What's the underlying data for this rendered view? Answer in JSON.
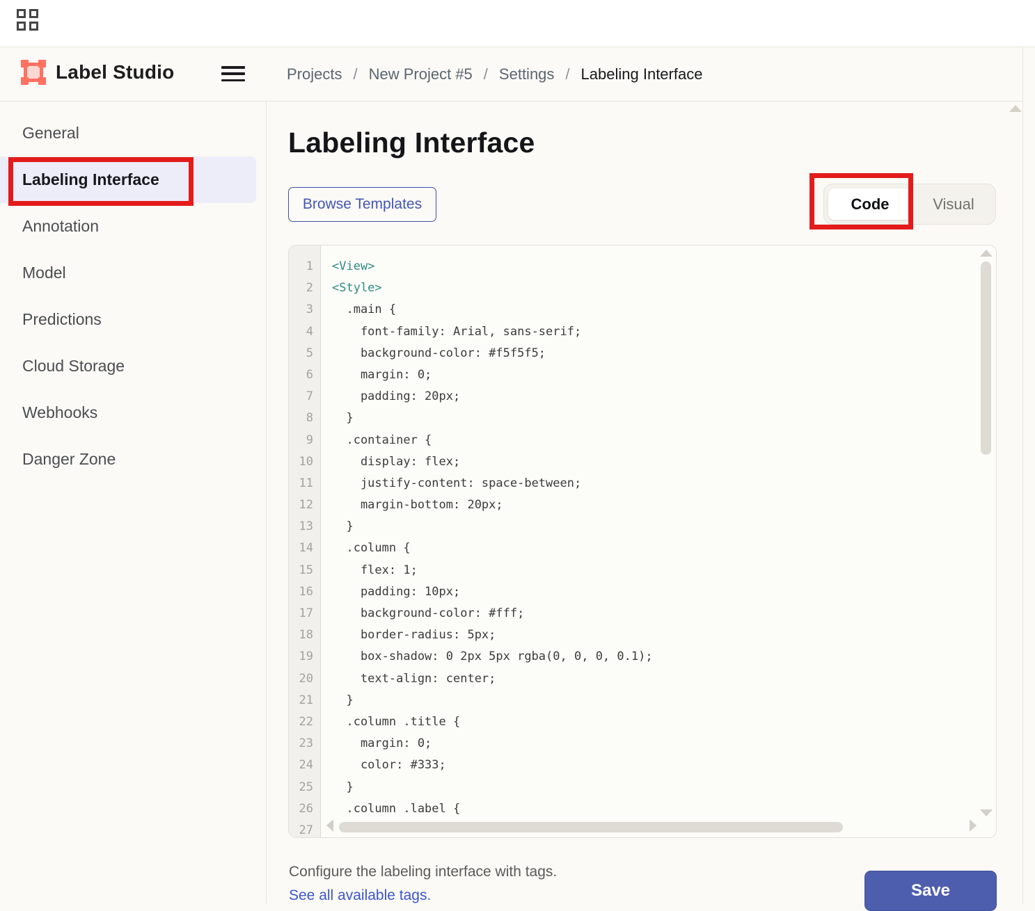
{
  "topbar": {
    "apps_icon": "apps-grid-icon"
  },
  "header": {
    "brand": "Label Studio",
    "separator": "/",
    "breadcrumbs": [
      "Projects",
      "New Project #5",
      "Settings",
      "Labeling Interface"
    ]
  },
  "sidebar": {
    "items": [
      {
        "label": "General",
        "active": false
      },
      {
        "label": "Labeling Interface",
        "active": true
      },
      {
        "label": "Annotation",
        "active": false
      },
      {
        "label": "Model",
        "active": false
      },
      {
        "label": "Predictions",
        "active": false
      },
      {
        "label": "Cloud Storage",
        "active": false
      },
      {
        "label": "Webhooks",
        "active": false
      },
      {
        "label": "Danger Zone",
        "active": false
      }
    ]
  },
  "main": {
    "title": "Labeling Interface",
    "browse_templates": "Browse Templates",
    "toggle": {
      "options": [
        "Code",
        "Visual"
      ],
      "active": "Code"
    },
    "editor": {
      "lines": [
        {
          "n": 1,
          "t": "<View>",
          "k": "tag"
        },
        {
          "n": 2,
          "t": "<Style>",
          "k": "tag"
        },
        {
          "n": 3,
          "t": "  .main {",
          "k": "code"
        },
        {
          "n": 4,
          "t": "    font-family: Arial, sans-serif;",
          "k": "code"
        },
        {
          "n": 5,
          "t": "    background-color: #f5f5f5;",
          "k": "code"
        },
        {
          "n": 6,
          "t": "    margin: 0;",
          "k": "code"
        },
        {
          "n": 7,
          "t": "    padding: 20px;",
          "k": "code"
        },
        {
          "n": 8,
          "t": "  }",
          "k": "code"
        },
        {
          "n": 9,
          "t": "  .container {",
          "k": "code"
        },
        {
          "n": 10,
          "t": "    display: flex;",
          "k": "code"
        },
        {
          "n": 11,
          "t": "    justify-content: space-between;",
          "k": "code"
        },
        {
          "n": 12,
          "t": "    margin-bottom: 20px;",
          "k": "code"
        },
        {
          "n": 13,
          "t": "  }",
          "k": "code"
        },
        {
          "n": 14,
          "t": "  .column {",
          "k": "code"
        },
        {
          "n": 15,
          "t": "    flex: 1;",
          "k": "code"
        },
        {
          "n": 16,
          "t": "    padding: 10px;",
          "k": "code"
        },
        {
          "n": 17,
          "t": "    background-color: #fff;",
          "k": "code"
        },
        {
          "n": 18,
          "t": "    border-radius: 5px;",
          "k": "code"
        },
        {
          "n": 19,
          "t": "    box-shadow: 0 2px 5px rgba(0, 0, 0, 0.1);",
          "k": "code"
        },
        {
          "n": 20,
          "t": "    text-align: center;",
          "k": "code"
        },
        {
          "n": 21,
          "t": "  }",
          "k": "code"
        },
        {
          "n": 22,
          "t": "  .column .title {",
          "k": "code"
        },
        {
          "n": 23,
          "t": "    margin: 0;",
          "k": "code"
        },
        {
          "n": 24,
          "t": "    color: #333;",
          "k": "code"
        },
        {
          "n": 25,
          "t": "  }",
          "k": "code"
        },
        {
          "n": 26,
          "t": "  .column .label {",
          "k": "code"
        },
        {
          "n": 27,
          "t": "",
          "k": "code"
        }
      ]
    },
    "footer": {
      "hint": "Configure the labeling interface with tags.",
      "link": "See all available tags.",
      "save": "Save"
    }
  },
  "annotations": {
    "highlight_color": "#e31b1b",
    "boxes": [
      "sidebar-labeling-interface",
      "code-toggle-button"
    ]
  },
  "colors": {
    "brand_coral": "#ff7262",
    "selected_item_bg": "#ededfa",
    "tag_teal": "#2e8b84",
    "save_button_blue": "#4e5eae",
    "link_blue": "#3c55cd",
    "annotation_red": "#e31b1b"
  }
}
